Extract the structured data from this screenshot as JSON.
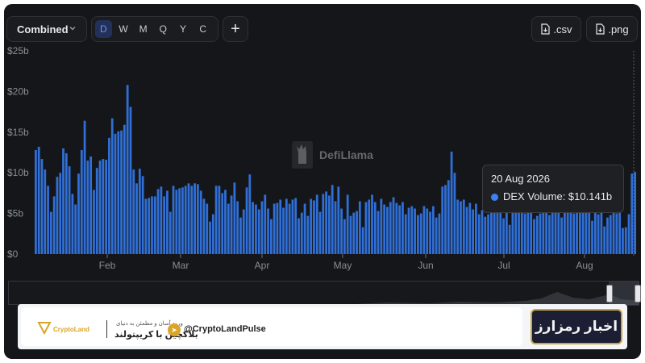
{
  "controls": {
    "mode": "Combined",
    "timeframes": [
      "D",
      "W",
      "M",
      "Q",
      "Y",
      "C"
    ],
    "active_timeframe": "D",
    "plus_label": "+",
    "csv_label": ".csv",
    "png_label": ".png"
  },
  "watermark": "DefiLlama",
  "tooltip": {
    "date": "20 Aug 2026",
    "label": "DEX Volume: $10.141b"
  },
  "banner": {
    "logo_text": "CryptoLand",
    "persian_line1": "ورود آسان و مطمئن به دنیای",
    "persian_line2": "بلاکچین با کریپتولند",
    "handle": "@CryptoLandPulse",
    "news_title": "اخبار رمزارز"
  },
  "colors": {
    "bar": "#2f6fd6",
    "background": "#151619"
  },
  "chart_data": {
    "type": "bar",
    "series_name": "DEX Volume",
    "unit": "$b",
    "ylim": [
      0,
      25
    ],
    "y_ticks": [
      "$0",
      "$5b",
      "$10b",
      "$15b",
      "$20b",
      "$25b"
    ],
    "x_ticks": [
      "Feb",
      "Mar",
      "Apr",
      "May",
      "Jun",
      "Jul",
      "Aug"
    ],
    "grid": false,
    "values": [
      12.8,
      13.2,
      11.7,
      10.4,
      8.4,
      5.2,
      7.1,
      9.5,
      10.0,
      13.0,
      12.4,
      10.8,
      7.4,
      6.1,
      9.9,
      12.8,
      16.4,
      11.5,
      12.0,
      7.9,
      10.6,
      11.5,
      11.7,
      11.6,
      14.3,
      16.7,
      14.8,
      15.1,
      15.2,
      15.9,
      20.8,
      18.1,
      10.4,
      8.7,
      10.5,
      9.6,
      6.8,
      6.9,
      7.1,
      7.1,
      8.0,
      8.3,
      7.1,
      7.8,
      5.2,
      8.4,
      7.9,
      8.1,
      8.2,
      8.4,
      8.7,
      8.4,
      8.7,
      8.6,
      7.8,
      6.8,
      6.2,
      4.0,
      4.9,
      8.4,
      8.4,
      7.5,
      7.9,
      6.2,
      7.2,
      8.8,
      6.5,
      4.5,
      5.5,
      8.2,
      9.8,
      6.4,
      6.1,
      5.5,
      6.5,
      7.3,
      5.6,
      4.3,
      6.2,
      6.3,
      6.7,
      5.7,
      6.8,
      6.2,
      6.7,
      6.9,
      4.4,
      5.1,
      6.2,
      4.7,
      6.8,
      6.6,
      7.3,
      5.2,
      7.4,
      7.7,
      7.2,
      8.5,
      6.5,
      8.3,
      5.6,
      4.3,
      7.3,
      4.7,
      5.1,
      5.3,
      6.5,
      3.3,
      6.4,
      6.7,
      7.3,
      6.4,
      5.3,
      6.8,
      6.1,
      5.8,
      6.4,
      7.0,
      6.3,
      6.0,
      6.4,
      4.9,
      5.7,
      5.9,
      5.6,
      4.8,
      5.0,
      5.9,
      5.6,
      5.2,
      5.9,
      4.5,
      5.0,
      8.3,
      8.5,
      9.1,
      12.6,
      10.0,
      6.7,
      6.5,
      6.7,
      5.8,
      6.3,
      5.5,
      6.2,
      4.9,
      5.4,
      4.6,
      4.9,
      6.5,
      5.8,
      6.5,
      5.6,
      4.4,
      6.2,
      3.6,
      5.9,
      5.8,
      5.5,
      6.0,
      5.0,
      5.5,
      5.4,
      4.3,
      4.7,
      5.0,
      5.6,
      6.1,
      4.8,
      5.5,
      5.4,
      5.7,
      4.5,
      5.3,
      5.3,
      5.4,
      5.0,
      5.4,
      5.5,
      5.6,
      5.1,
      5.2,
      4.1,
      5.1,
      4.9,
      5.7,
      3.4,
      4.5,
      4.8,
      5.2,
      5.0,
      5.4,
      3.2,
      3.3,
      4.9,
      9.9,
      10.1
    ]
  }
}
